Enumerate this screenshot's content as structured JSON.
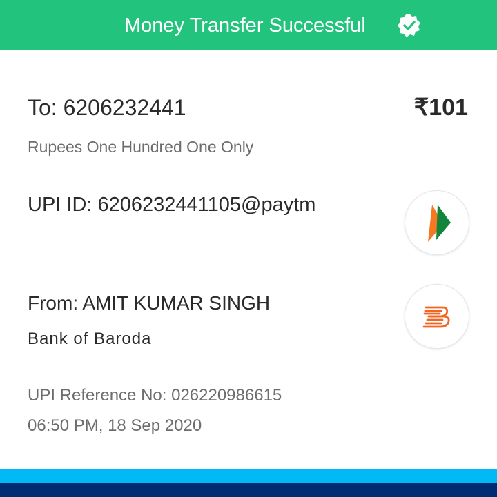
{
  "header": {
    "title": "Money Transfer Successful",
    "badge_icon": "verified-check-icon",
    "background_color": "#22c37c"
  },
  "transaction": {
    "to_label": "To: 6206232441",
    "amount": "₹101",
    "amount_in_words": "Rupees One Hundred One Only",
    "upi_id": "UPI ID: 6206232441105@paytm",
    "from_label": "From: AMIT KUMAR SINGH",
    "bank_name": "Bank of Baroda",
    "reference_no": "UPI Reference No: 026220986615",
    "datetime": "06:50 PM, 18 Sep 2020"
  },
  "logos": {
    "upi_logo_icon": "upi-logo-icon",
    "bank_logo_icon": "bank-of-baroda-logo-icon"
  },
  "footer": {
    "light_bar_color": "#00b9f5",
    "dark_bar_color": "#012b72"
  }
}
